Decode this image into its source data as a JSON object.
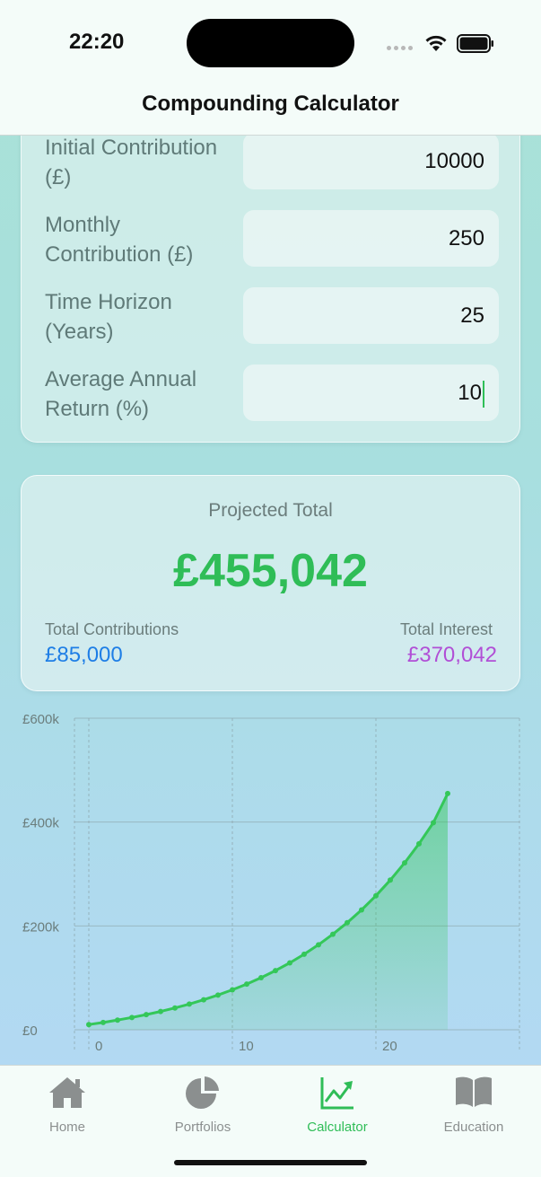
{
  "status_bar": {
    "time": "22:20"
  },
  "nav": {
    "title": "Compounding Calculator"
  },
  "inputs": [
    {
      "label": "Initial Contribution (£)",
      "value": "10000"
    },
    {
      "label": "Monthly Contribution (£)",
      "value": "250"
    },
    {
      "label": "Time Horizon (Years)",
      "value": "25"
    },
    {
      "label": "Average Annual Return (%)",
      "value": "10"
    }
  ],
  "summary": {
    "projected_label": "Projected Total",
    "projected_value": "£455,042",
    "contributions_label": "Total Contributions",
    "contributions_value": "£85,000",
    "interest_label": "Total Interest",
    "interest_value": "£370,042"
  },
  "chart_data": {
    "type": "area",
    "x": [
      0,
      1,
      2,
      3,
      4,
      5,
      6,
      7,
      8,
      9,
      10,
      11,
      12,
      13,
      14,
      15,
      16,
      17,
      18,
      19,
      20,
      21,
      22,
      23,
      24,
      25
    ],
    "values": [
      10000,
      14062,
      18601,
      23613,
      29150,
      35267,
      42024,
      49489,
      57735,
      66845,
      76909,
      88026,
      100308,
      113875,
      128863,
      145420,
      163711,
      183917,
      206238,
      230897,
      258138,
      288231,
      321476,
      358201,
      398773,
      455042
    ],
    "ylim": [
      0,
      600000
    ],
    "xlim": [
      -1,
      30
    ],
    "y_ticks": [
      "£0",
      "£200k",
      "£400k",
      "£600k"
    ],
    "x_ticks": [
      "0",
      "10",
      "20"
    ],
    "grid": true,
    "color": "#34c759"
  },
  "tabs": [
    {
      "label": "Home",
      "icon": "house-icon",
      "active": false
    },
    {
      "label": "Portfolios",
      "icon": "pie-chart-icon",
      "active": false
    },
    {
      "label": "Calculator",
      "icon": "chart-trend-icon",
      "active": true
    },
    {
      "label": "Education",
      "icon": "book-icon",
      "active": false
    }
  ]
}
